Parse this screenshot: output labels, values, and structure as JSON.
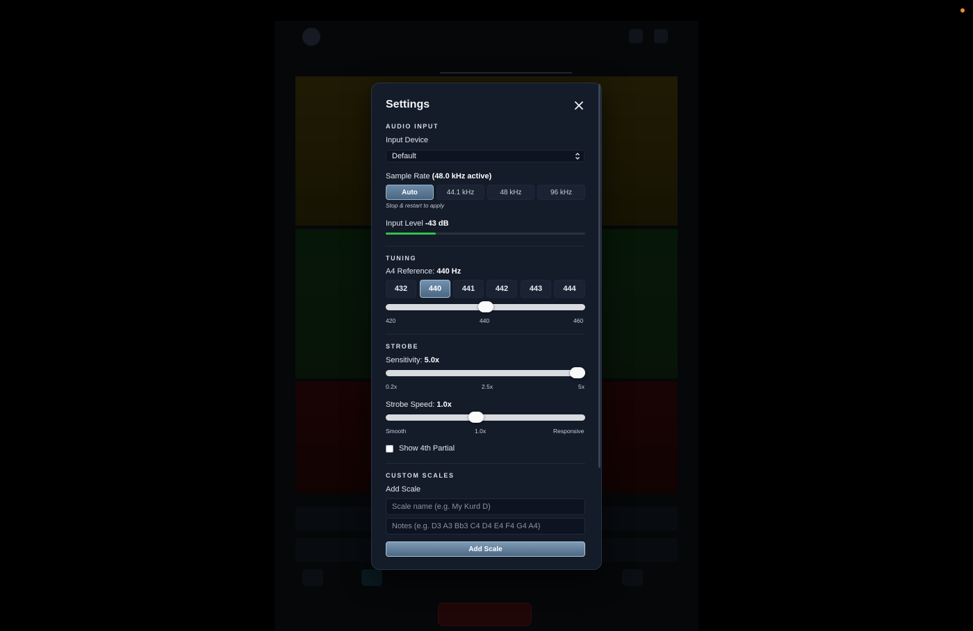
{
  "modal": {
    "title": "Settings",
    "audio_input": {
      "section_title": "AUDIO INPUT",
      "input_device_label": "Input Device",
      "input_device_value": "Default",
      "sample_rate_label": "Sample Rate",
      "sample_rate_active": "(48.0 kHz active)",
      "sample_rate_options": [
        "Auto",
        "44.1 kHz",
        "48 kHz",
        "96 kHz"
      ],
      "sample_rate_selected": "Auto",
      "restart_hint": "Stop & restart to apply",
      "input_level_label": "Input Level",
      "input_level_value": "-43 dB",
      "input_level_fraction": 0.25
    },
    "tuning": {
      "section_title": "TUNING",
      "a4_label": "A4 Reference:",
      "a4_value": "440 Hz",
      "presets": [
        "432",
        "440",
        "441",
        "442",
        "443",
        "444"
      ],
      "preset_selected": "440",
      "slider": {
        "min": 420,
        "max": 460,
        "value": 440
      },
      "ticks": [
        "420",
        "440",
        "460"
      ]
    },
    "strobe": {
      "section_title": "STROBE",
      "sensitivity_label": "Sensitivity:",
      "sensitivity_value": "5.0x",
      "sensitivity_slider": {
        "min": 0.2,
        "max": 5,
        "value": 5
      },
      "sensitivity_ticks": [
        "0.2x",
        "2.5x",
        "5x"
      ],
      "speed_label": "Strobe Speed:",
      "speed_value": "1.0x",
      "speed_fraction": 0.45,
      "speed_ticks": [
        "Smooth",
        "1.0x",
        "Responsive"
      ],
      "show_partial_label": "Show 4th Partial",
      "show_partial_checked": false
    },
    "custom_scales": {
      "section_title": "CUSTOM SCALES",
      "add_scale_label": "Add Scale",
      "name_placeholder": "Scale name (e.g. My Kurd D)",
      "notes_placeholder": "Notes (e.g. D3 A3 Bb3 C4 D4 E4 F4 G4 A4)",
      "add_button": "Add Scale"
    }
  },
  "colors": {
    "accent": "#5b7896",
    "level": "#34c24a",
    "modal_bg": "#141b29"
  },
  "icons": {
    "close": "close-icon",
    "select": "chevron-updown-icon"
  }
}
